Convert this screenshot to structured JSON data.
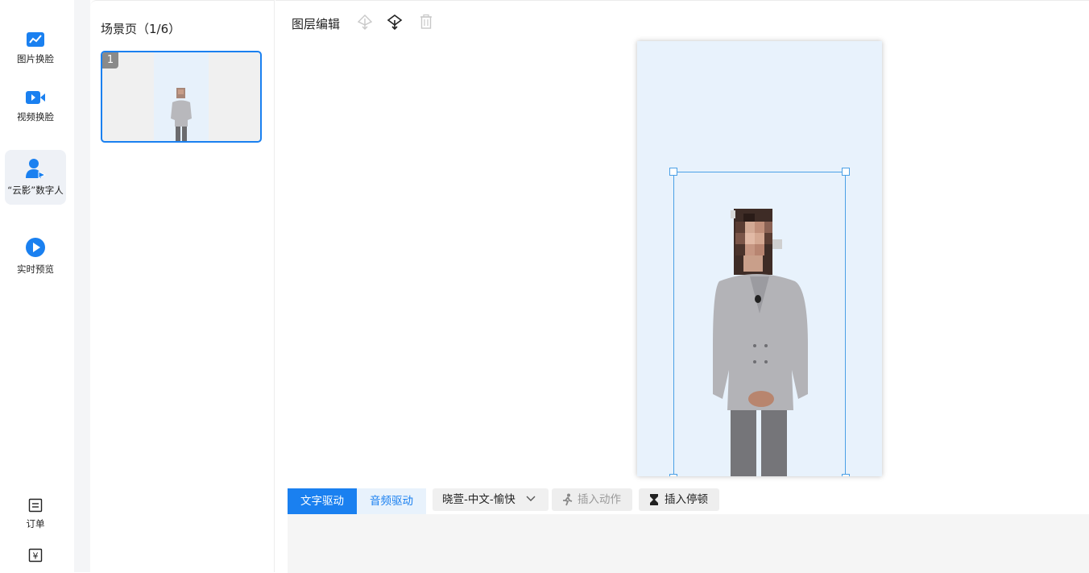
{
  "nav": {
    "items": [
      {
        "label": "图片换脸",
        "icon": "image-chart-icon"
      },
      {
        "label": "视频换脸",
        "icon": "video-camera-icon"
      },
      {
        "label": "“云影”数字人",
        "icon": "digital-human-icon"
      },
      {
        "label": "实时预览",
        "icon": "play-circle-icon"
      },
      {
        "label": "订单",
        "icon": "order-list-icon"
      },
      {
        "label": "¥",
        "icon": "yen-icon"
      }
    ],
    "active": "“云影”数字人"
  },
  "scene": {
    "title": "场景页（1/6）",
    "thumb_number": "1"
  },
  "editor": {
    "layer_title": "图层编辑",
    "tools": [
      "move-up-layer-icon",
      "move-down-layer-icon",
      "trash-icon"
    ]
  },
  "bottom": {
    "tabs": [
      "文字驱动",
      "音频驱动"
    ],
    "active_tab": "文字驱动",
    "voice": "晓萱-中文-愉快",
    "insert_action": "插入动作",
    "insert_pause": "插入停顿"
  },
  "colors": {
    "accent": "#1a80f0",
    "canvas_bg": "#e8f2fc"
  }
}
